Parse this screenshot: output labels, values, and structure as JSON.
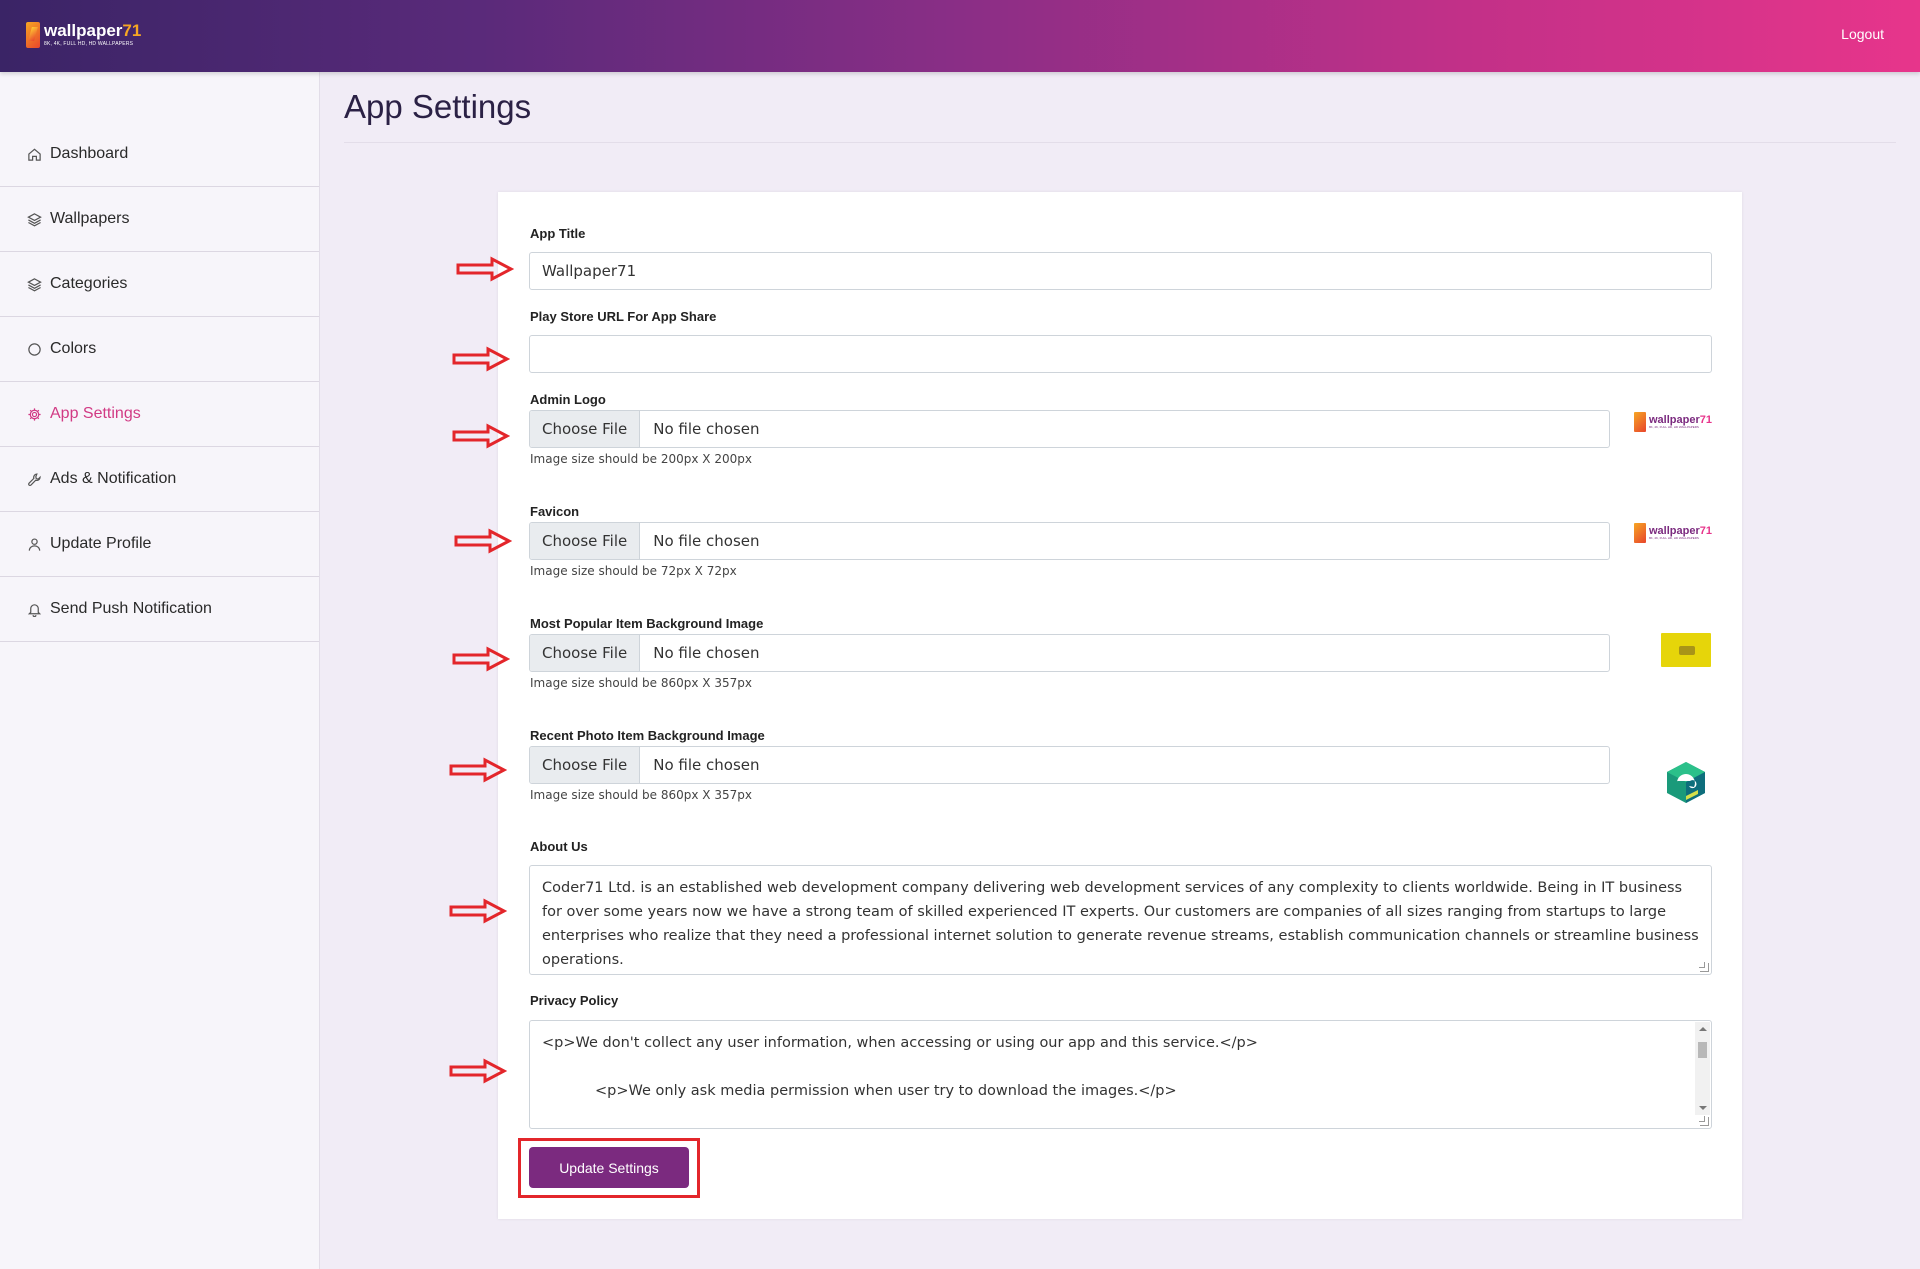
{
  "header": {
    "logo_text": "wallpaper",
    "logo_num": "71",
    "logo_sub": "8K, 4K, FULL HD, HD WALLPAPERS",
    "logout_label": "Logout"
  },
  "sidebar": {
    "items": [
      {
        "label": "Dashboard",
        "icon": "home-icon"
      },
      {
        "label": "Wallpapers",
        "icon": "layers-icon"
      },
      {
        "label": "Categories",
        "icon": "layers-icon"
      },
      {
        "label": "Colors",
        "icon": "circle-icon"
      },
      {
        "label": "App Settings",
        "icon": "gear-icon",
        "active": true
      },
      {
        "label": "Ads & Notification",
        "icon": "wrench-icon"
      },
      {
        "label": "Update Profile",
        "icon": "user-icon"
      },
      {
        "label": "Send Push Notification",
        "icon": "bell-icon"
      }
    ]
  },
  "page": {
    "title": "App Settings"
  },
  "form": {
    "app_title": {
      "label": "App Title",
      "value": "Wallpaper71"
    },
    "play_store_url": {
      "label": "Play Store URL For App Share",
      "value": ""
    },
    "admin_logo": {
      "label": "Admin Logo",
      "button": "Choose File",
      "file": "No file chosen",
      "hint": "Image size should be 200px X 200px"
    },
    "favicon": {
      "label": "Favicon",
      "button": "Choose File",
      "file": "No file chosen",
      "hint": "Image size should be 72px X 72px"
    },
    "popular_bg": {
      "label": "Most Popular Item Background Image",
      "button": "Choose File",
      "file": "No file chosen",
      "hint": "Image size should be 860px X 357px"
    },
    "recent_bg": {
      "label": "Recent Photo Item Background Image",
      "button": "Choose File",
      "file": "No file chosen",
      "hint": "Image size should be 860px X 357px"
    },
    "about_us": {
      "label": "About Us",
      "value": "Coder71 Ltd. is an established web development company delivering web development services of any complexity to clients worldwide. Being in IT business for over some years now we have a strong team of skilled experienced IT experts. Our customers are companies of all sizes ranging from startups to large enterprises who realize that they need a professional internet solution to generate revenue streams, establish communication channels or streamline business operations."
    },
    "privacy_policy": {
      "label": "Privacy Policy",
      "line1": "<p>We don't collect any user information, when accessing or using our app and this service.</p>",
      "line2": "<p>We only ask media permission when user try to download the images.</p>"
    },
    "submit_label": "Update Settings"
  },
  "colors": {
    "accent": "#d13a84",
    "button": "#7b2a7f",
    "annotation": "#e3262b"
  }
}
